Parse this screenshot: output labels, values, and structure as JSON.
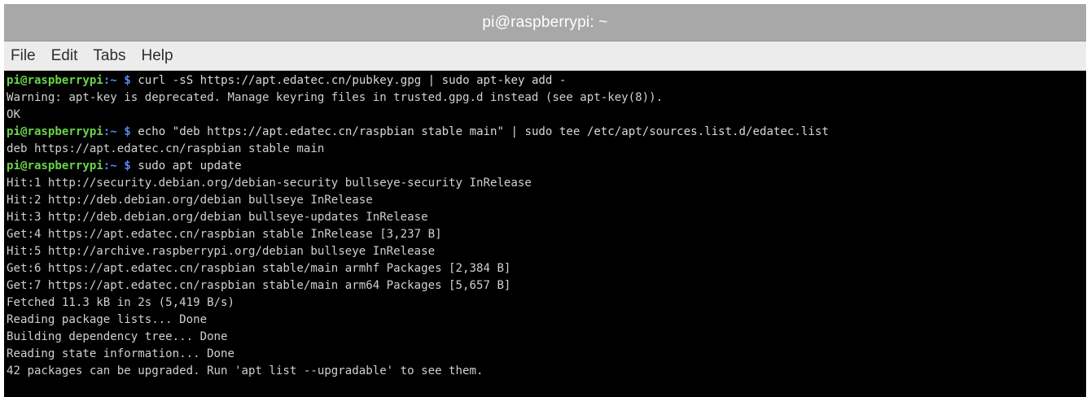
{
  "window": {
    "title": "pi@raspberrypi: ~"
  },
  "menubar": {
    "items": [
      "File",
      "Edit",
      "Tabs",
      "Help"
    ]
  },
  "colors": {
    "prompt_user": "#6ad34a",
    "prompt_path": "#5a86f0",
    "terminal_bg": "#000000",
    "terminal_fg": "#d0d0d0",
    "titlebar_bg": "#a8a8a8"
  },
  "terminal": {
    "prompt": {
      "user": "pi@raspberrypi",
      "sep": ":",
      "path": "~",
      "sigil": "$"
    },
    "lines": [
      {
        "type": "prompt",
        "cmd": "curl -sS https://apt.edatec.cn/pubkey.gpg | sudo apt-key add -"
      },
      {
        "type": "out",
        "text": "Warning: apt-key is deprecated. Manage keyring files in trusted.gpg.d instead (see apt-key(8))."
      },
      {
        "type": "out",
        "text": "OK"
      },
      {
        "type": "prompt",
        "cmd": "echo \"deb https://apt.edatec.cn/raspbian stable main\" | sudo tee /etc/apt/sources.list.d/edatec.list"
      },
      {
        "type": "out",
        "text": "deb https://apt.edatec.cn/raspbian stable main"
      },
      {
        "type": "prompt",
        "cmd": "sudo apt update"
      },
      {
        "type": "out",
        "text": "Hit:1 http://security.debian.org/debian-security bullseye-security InRelease"
      },
      {
        "type": "out",
        "text": "Hit:2 http://deb.debian.org/debian bullseye InRelease"
      },
      {
        "type": "out",
        "text": "Hit:3 http://deb.debian.org/debian bullseye-updates InRelease"
      },
      {
        "type": "out",
        "text": "Get:4 https://apt.edatec.cn/raspbian stable InRelease [3,237 B]"
      },
      {
        "type": "out",
        "text": "Hit:5 http://archive.raspberrypi.org/debian bullseye InRelease"
      },
      {
        "type": "out",
        "text": "Get:6 https://apt.edatec.cn/raspbian stable/main armhf Packages [2,384 B]"
      },
      {
        "type": "out",
        "text": "Get:7 https://apt.edatec.cn/raspbian stable/main arm64 Packages [5,657 B]"
      },
      {
        "type": "out",
        "text": "Fetched 11.3 kB in 2s (5,419 B/s)"
      },
      {
        "type": "out",
        "text": "Reading package lists... Done"
      },
      {
        "type": "out",
        "text": "Building dependency tree... Done"
      },
      {
        "type": "out",
        "text": "Reading state information... Done"
      },
      {
        "type": "out",
        "text": "42 packages can be upgraded. Run 'apt list --upgradable' to see them."
      }
    ]
  }
}
